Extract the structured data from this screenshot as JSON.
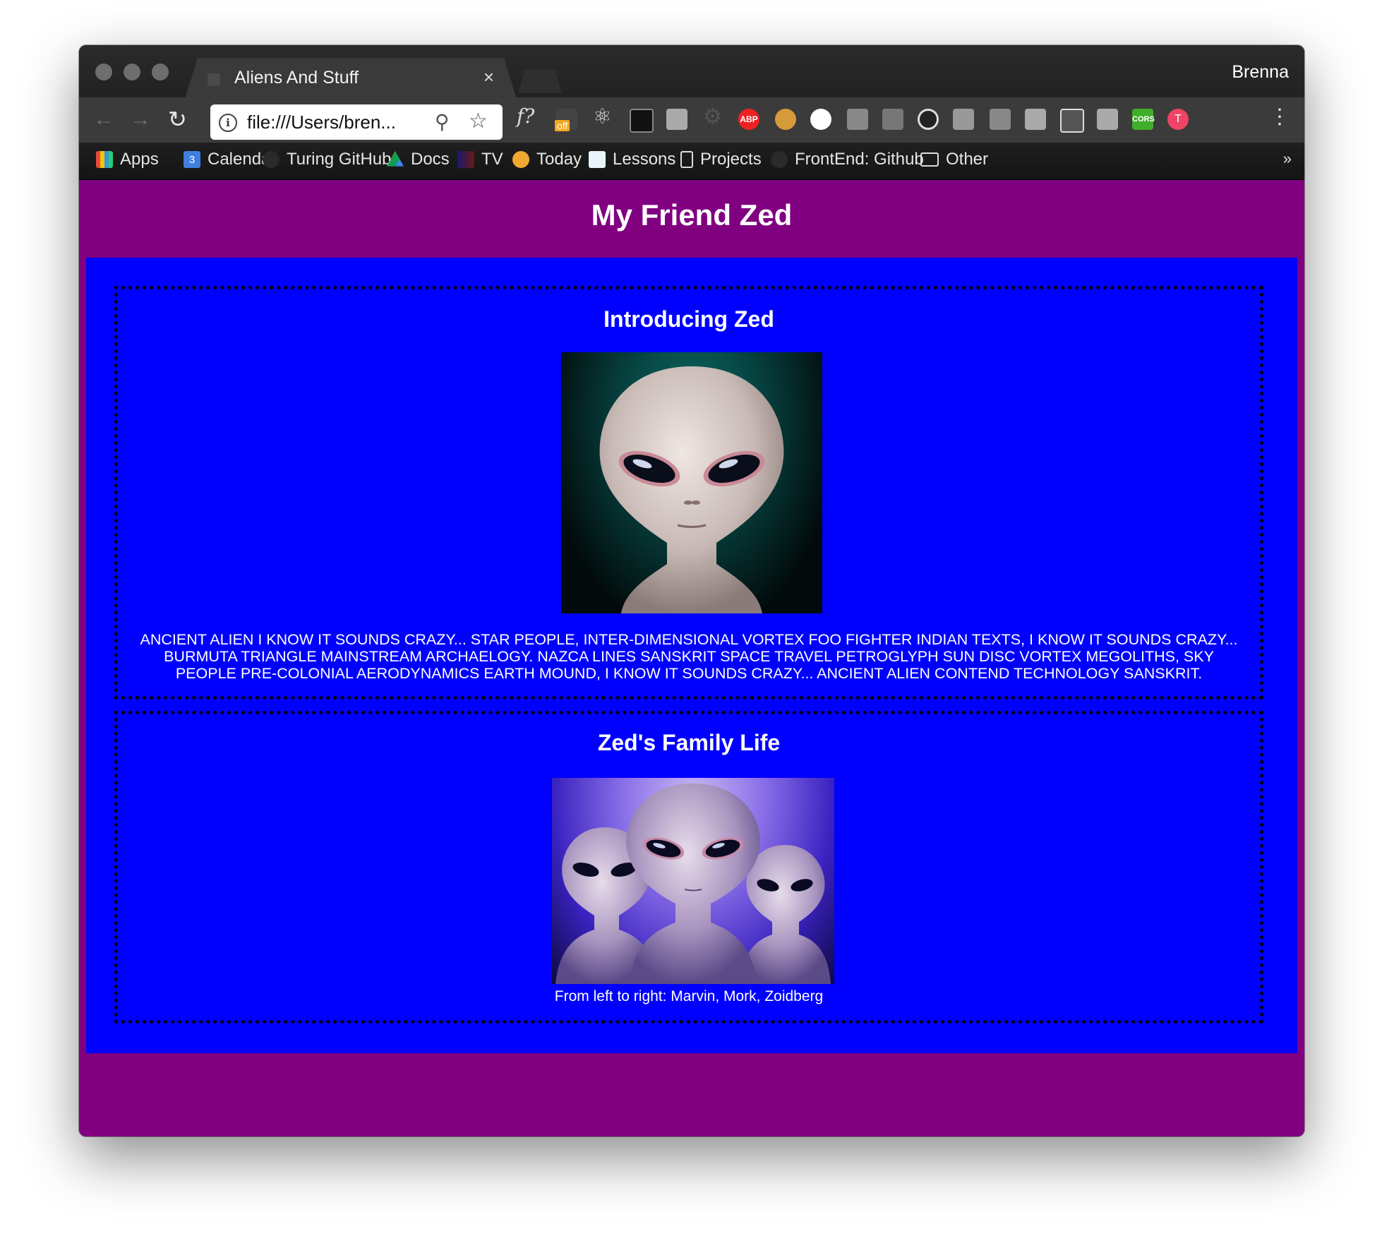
{
  "browser": {
    "tab_title": "Aliens And Stuff",
    "tab_close": "×",
    "profile_name": "Brenna",
    "url": "file:///Users/bren...",
    "extensions": {
      "fquestion": "f?",
      "off_badge": "off",
      "abp": "ABP",
      "cors": "CORS",
      "t": "T"
    },
    "bookmarks": [
      {
        "label": "Apps",
        "icon": "apps-grid-icon"
      },
      {
        "label": "Calendar",
        "icon": "calendar-icon",
        "badge": "3"
      },
      {
        "label": "Turing GitHub",
        "icon": "github-icon"
      },
      {
        "label": "Docs",
        "icon": "drive-icon"
      },
      {
        "label": "TV",
        "icon": "tv-icon"
      },
      {
        "label": "Today",
        "icon": "today-icon"
      },
      {
        "label": "Lessons",
        "icon": "lessons-icon"
      },
      {
        "label": "Projects",
        "icon": "page-icon"
      },
      {
        "label": "FrontEnd: Github",
        "icon": "github-icon"
      },
      {
        "label": "Other",
        "icon": "folder-icon"
      }
    ],
    "more_bookmarks": "»"
  },
  "page": {
    "title": "My Friend Zed",
    "sections": [
      {
        "heading": "Introducing Zed",
        "image": "alien-portrait",
        "text": "ANCIENT ALIEN I KNOW IT SOUNDS CRAZY... STAR PEOPLE, INTER-DIMENSIONAL VORTEX FOO FIGHTER INDIAN TEXTS, I KNOW IT SOUNDS CRAZY... BURMUTA TRIANGLE MAINSTREAM ARCHAELOGY. NAZCA LINES SANSKRIT SPACE TRAVEL PETROGLYPH SUN DISC VORTEX MEGOLITHS, SKY PEOPLE PRE-COLONIAL AERODYNAMICS EARTH MOUND, I KNOW IT SOUNDS CRAZY... ANCIENT ALIEN CONTEND TECHNOLOGY SANSKRIT."
      },
      {
        "heading": "Zed's Family Life",
        "image": "alien-family",
        "caption": "From left to right: Marvin, Mork, Zoidberg"
      }
    ]
  },
  "colors": {
    "page_bg": "#800080",
    "main_bg": "#0000ff",
    "text": "#ffffff"
  }
}
